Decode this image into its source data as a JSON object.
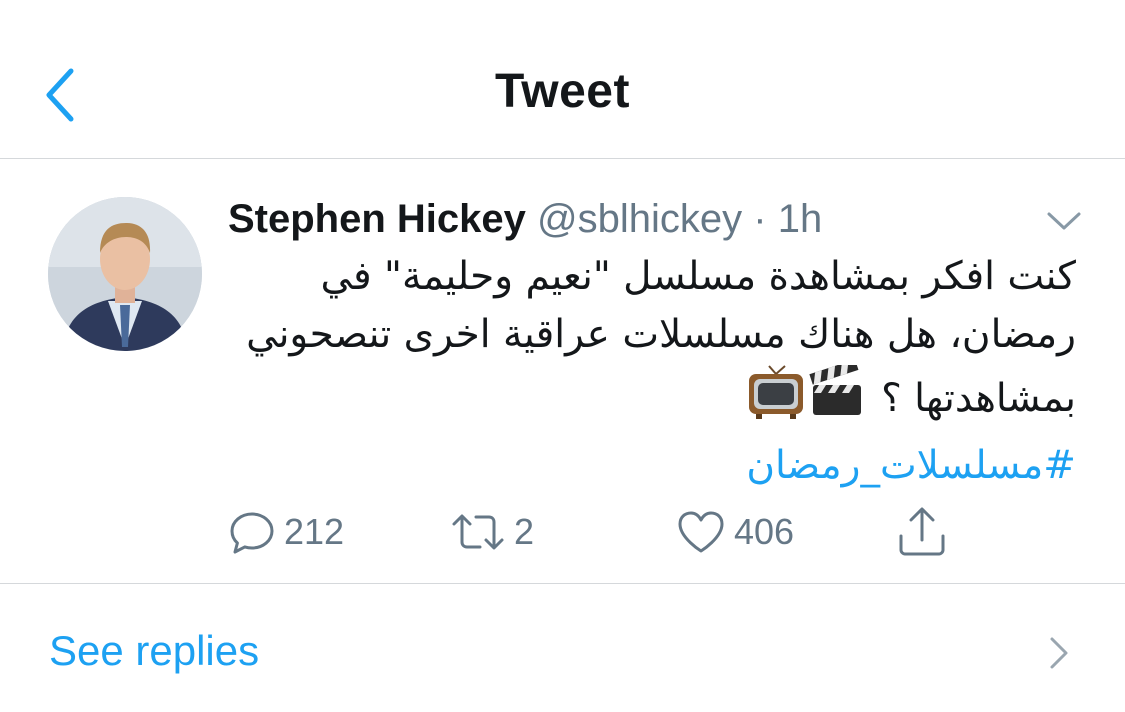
{
  "header": {
    "title": "Tweet",
    "back_icon": "chevron-left-icon"
  },
  "tweet": {
    "author_name": "Stephen Hickey",
    "author_handle": "@sblhickey",
    "separator": "·",
    "timestamp": "1h",
    "text": "كنت افكر بمشاهدة مسلسل \"نعيم وحليمة\" في رمضان، هل هناك مسلسلات عراقية اخرى تنصحوني بمشاهدتها ؟",
    "emojis": [
      "clapperboard-icon",
      "television-icon"
    ],
    "hashtag": "#مسلسلات_رمضان",
    "actions": {
      "replies": "212",
      "retweets": "2",
      "likes": "406"
    }
  },
  "footer": {
    "see_replies_label": "See replies"
  },
  "colors": {
    "accent": "#1da1f2",
    "secondary_text": "#657786",
    "divider": "#d5d8db"
  }
}
